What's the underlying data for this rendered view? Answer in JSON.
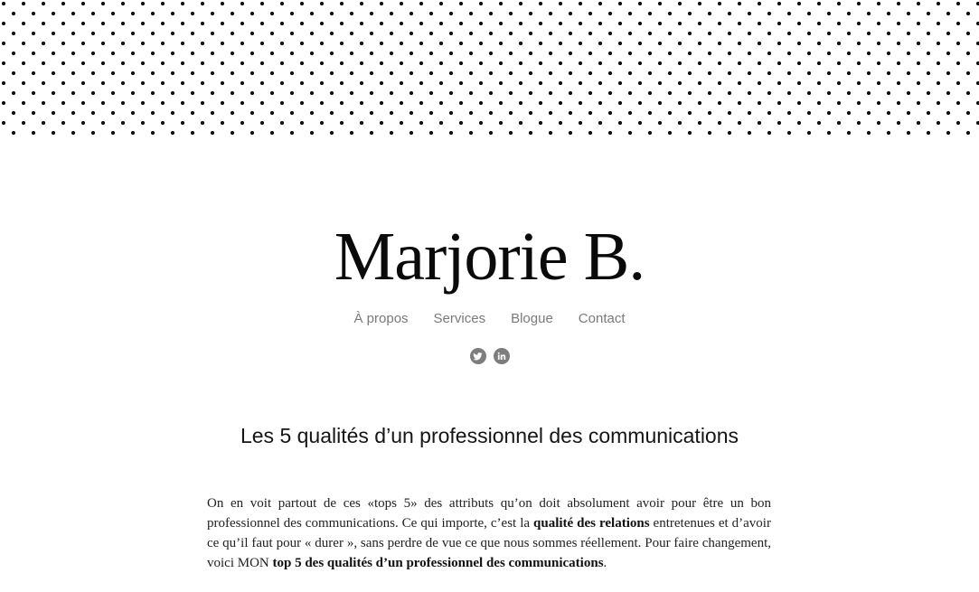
{
  "site": {
    "title": "Marjorie B."
  },
  "nav": {
    "items": [
      {
        "label": "À propos"
      },
      {
        "label": "Services"
      },
      {
        "label": "Blogue"
      },
      {
        "label": "Contact"
      }
    ]
  },
  "social": {
    "icons": [
      "twitter-icon",
      "linkedin-icon"
    ],
    "icon_color": "#7d7d7d"
  },
  "post": {
    "title": "Les 5 qualités d’un professionnel des communications",
    "intro_part1": "On en voit partout de ces «tops 5» des attributs qu’on doit absolument avoir pour être un bon professionnel des communications. Ce qui importe, c’est la ",
    "intro_bold1": "qualité des relations",
    "intro_part2": " entretenues et d’avoir ce qu’il faut pour « durer », sans perdre de vue ce que nous sommes réellement. Pour faire changement, voici MON ",
    "intro_bold2": "top 5 des qualités d’un professionnel des communications",
    "intro_part3": "."
  },
  "colors": {
    "nav_text": "#7a7a7a",
    "dots": "#111111",
    "background": "#ffffff"
  }
}
